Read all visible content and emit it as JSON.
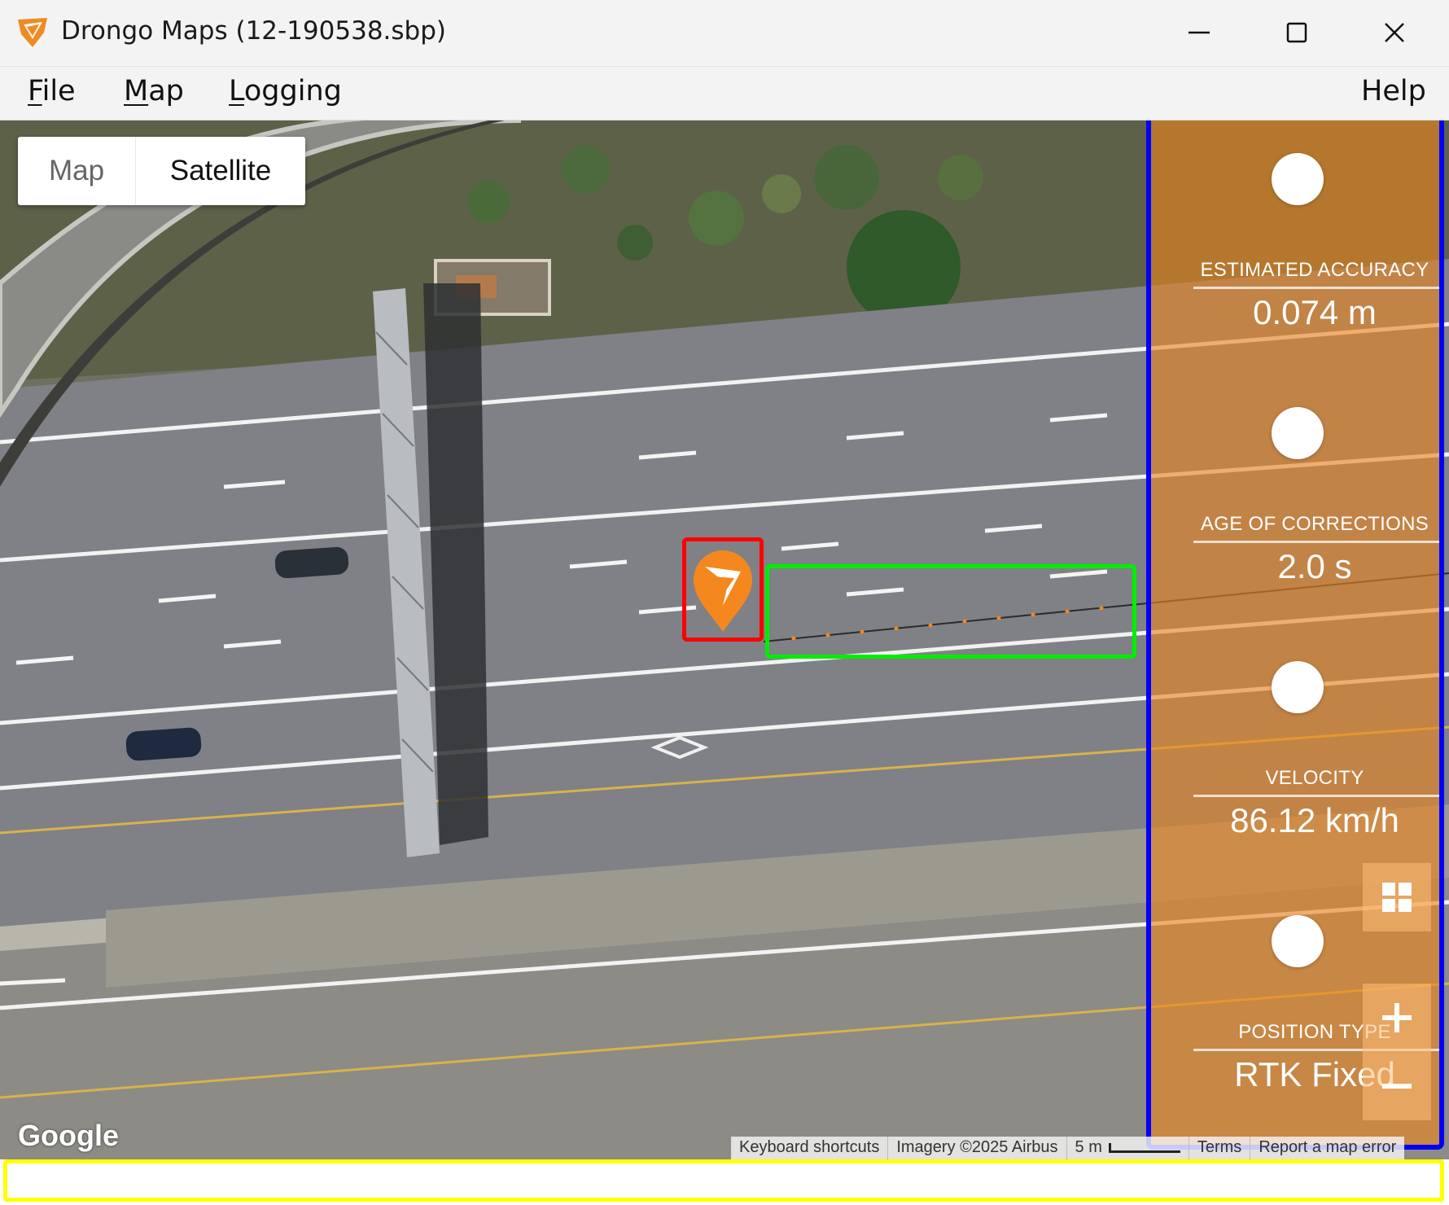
{
  "window": {
    "title": "Drongo Maps (12-190538.sbp)",
    "controls": {
      "minimize_icon": "minimize-icon",
      "maximize_icon": "maximize-icon",
      "close_icon": "close-icon"
    }
  },
  "menu": {
    "file": {
      "mnemonic": "F",
      "rest": "ile"
    },
    "map": {
      "mnemonic": "M",
      "rest": "ap"
    },
    "logging": {
      "mnemonic": "L",
      "rest": "ogging"
    },
    "help": "Help"
  },
  "map": {
    "map_type_options": [
      "Map",
      "Satellite"
    ],
    "map_type_map": "Map",
    "map_type_satellite": "Satellite",
    "selected_map_type": "Satellite",
    "google_logo": "Google",
    "attribution": {
      "keyboard_shortcuts": "Keyboard shortcuts",
      "imagery": "Imagery ©2025 Airbus",
      "scale": "5 m",
      "terms": "Terms",
      "report": "Report a map error"
    },
    "marker_icon": "drongo-location-marker-icon",
    "accent_color": "#f5871f",
    "annotations": {
      "marker_box_color": "#ff0000",
      "track_box_color": "#00ee00",
      "stats_panel_box_color": "#0000ff",
      "status_bar_box_color": "#ffff00"
    }
  },
  "stats": {
    "estimated_accuracy": {
      "label": "ESTIMATED ACCURACY",
      "value": "0.074 m"
    },
    "age_of_corrections": {
      "label": "AGE OF CORRECTIONS",
      "value": "2.0 s"
    },
    "velocity": {
      "label": "VELOCITY",
      "value": "86.12 km/h"
    },
    "position_type": {
      "label": "POSITION TYPE",
      "value": "RTK Fixed"
    }
  },
  "map_controls": {
    "layout_icon": "grid-icon",
    "zoom_in_icon": "plus-icon",
    "zoom_out_icon": "minus-icon"
  },
  "status_bar": {
    "text": ""
  }
}
